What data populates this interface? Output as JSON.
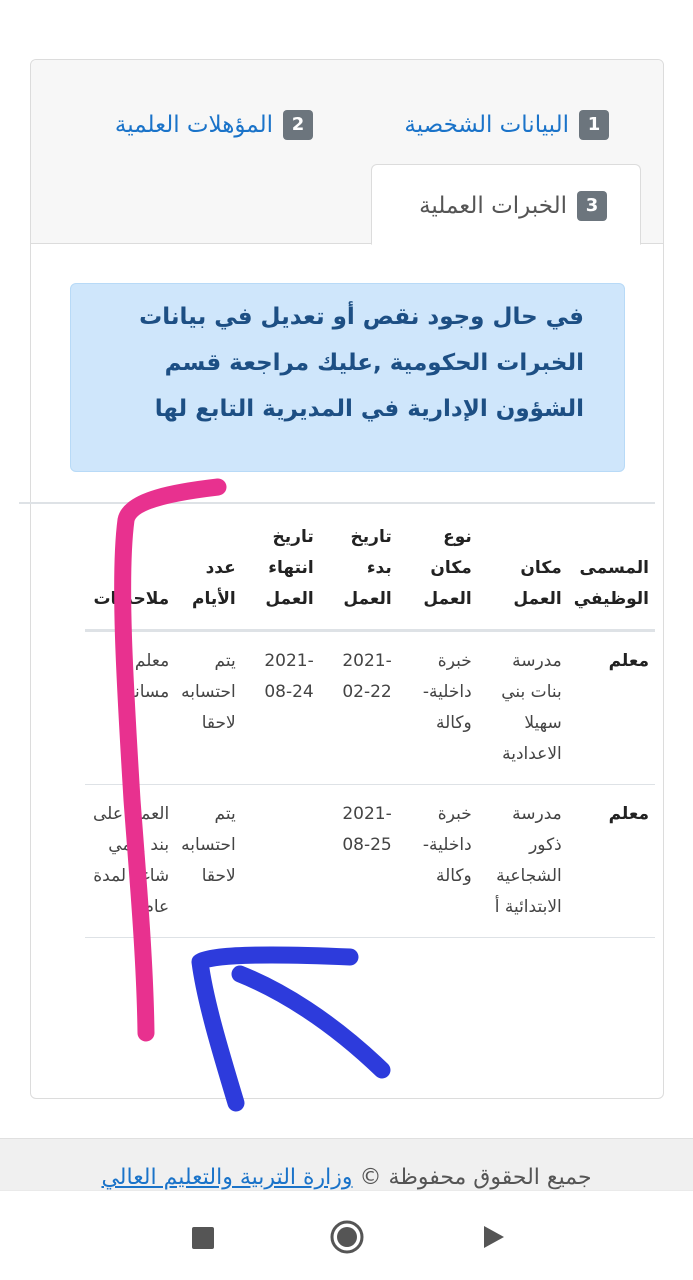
{
  "tabs": [
    {
      "num": "1",
      "label": "البيانات الشخصية"
    },
    {
      "num": "2",
      "label": "المؤهلات العلمية"
    },
    {
      "num": "3",
      "label": "الخبرات العملية"
    }
  ],
  "alert": {
    "line1": "في حال وجود نقص أو تعديل في بيانات",
    "line2": "الخبرات الحكومية ,عليك مراجعة قسم",
    "line3": "الشؤون الإدارية في المديرية التابع لها"
  },
  "table": {
    "headers": {
      "title": "المسمى الوظيفي",
      "place": "مكان العمل",
      "type": "نوع مكان العمل",
      "start": "تاريخ بدء العمل",
      "end": "تاريخ انتهاء العمل",
      "days": "عدد الأيام",
      "notes": "ملاحظات"
    },
    "rows": [
      {
        "title": "معلم",
        "place": "مدرسة بنات بني سهيلا الاعدادية",
        "type": "خبرة داخلية- وكالة",
        "start": "2021-02-22",
        "end": "2021-08-24",
        "days": "يتم احتسابه لاحقا",
        "notes": "معلم مساند"
      },
      {
        "title": "معلم",
        "place": "مدرسة ذكور الشجاعية الابتدائية أ",
        "type": "خبرة داخلية- وكالة",
        "start": "2021-08-25",
        "end": "",
        "days": "يتم احتسابه لاحقا",
        "notes": "العمل على بند يومي شاغر لمدة عام"
      }
    ]
  },
  "footer": {
    "text": "جميع الحقوق محفوظة ©",
    "link": "وزارة التربية والتعليم العالي"
  },
  "colors": {
    "link": "#1a73c9",
    "alert_bg": "#cfe6fb",
    "annotation_pink": "#e8318f",
    "annotation_blue": "#2d3bdc"
  },
  "icons": [
    "stop-square-icon",
    "home-circle-icon",
    "back-triangle-icon"
  ]
}
